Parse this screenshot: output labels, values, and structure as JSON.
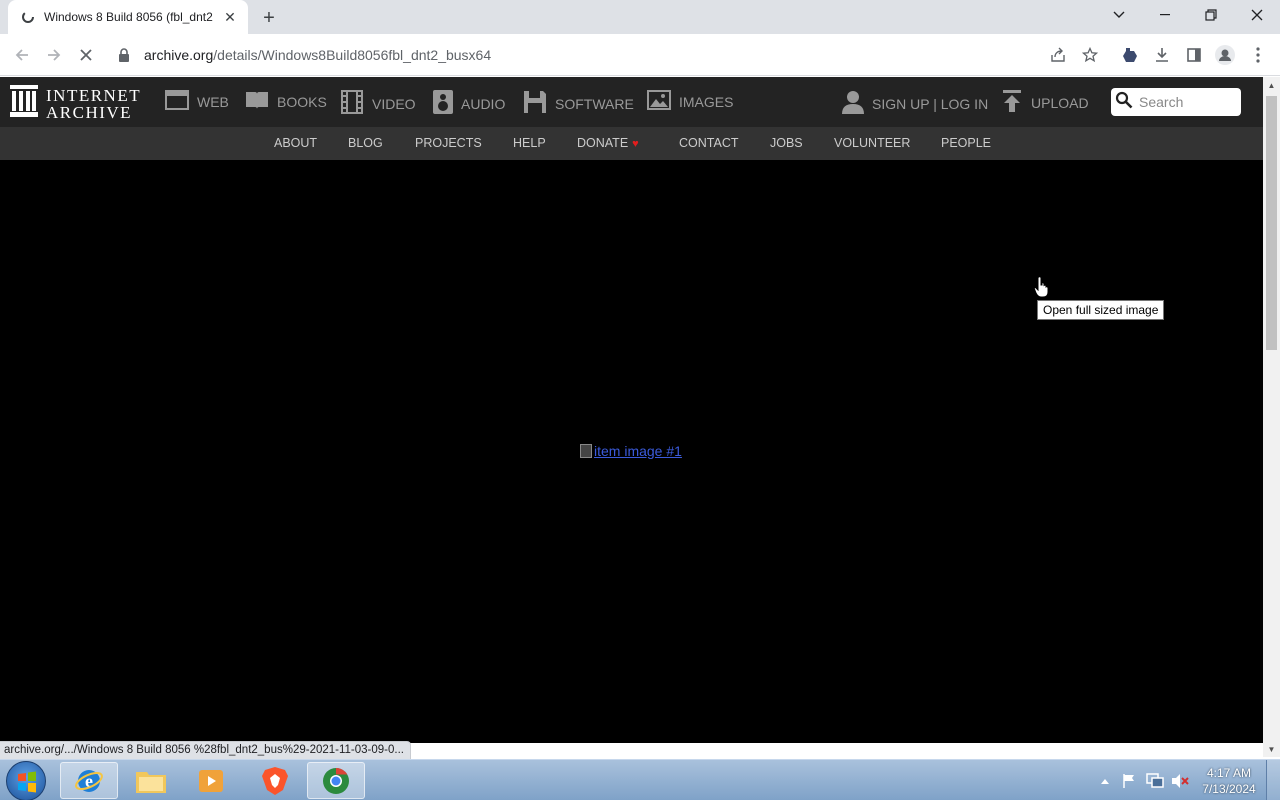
{
  "browser": {
    "tab_title": "Windows 8 Build 8056 (fbl_dnt2",
    "url_host": "archive.org",
    "url_path": "/details/Windows8Build8056fbl_dnt2_busx64",
    "status_url": "archive.org/.../Windows 8 Build 8056 %28fbl_dnt2_bus%29-2021-11-03-09-0..."
  },
  "ia": {
    "logo_line1": "INTERNET",
    "logo_line2": "ARCHIVE",
    "media": [
      "WEB",
      "BOOKS",
      "VIDEO",
      "AUDIO",
      "SOFTWARE",
      "IMAGES"
    ],
    "signin": "SIGN UP | LOG IN",
    "upload": "UPLOAD",
    "search_placeholder": "Search",
    "sub_nav": [
      "ABOUT",
      "BLOG",
      "PROJECTS",
      "HELP",
      "DONATE",
      "CONTACT",
      "JOBS",
      "VOLUNTEER",
      "PEOPLE"
    ]
  },
  "main": {
    "item_image_alt": "item image #1",
    "tooltip": "Open full sized image"
  },
  "taskbar": {
    "time": "4:17 AM",
    "date": "7/13/2024"
  },
  "colors": {
    "ia_header": "#232323",
    "ia_subnav": "#333333",
    "link": "#3b5bdb",
    "donate_heart": "#e31d1d"
  }
}
